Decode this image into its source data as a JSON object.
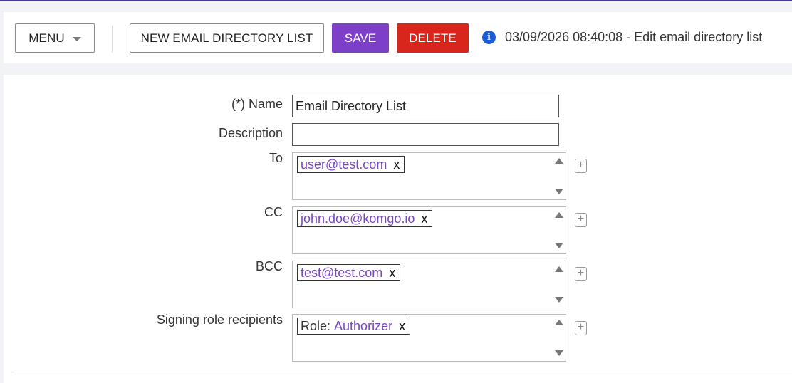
{
  "toolbar": {
    "menu_label": "MENU",
    "new_label": "NEW EMAIL DIRECTORY LIST",
    "save_label": "SAVE",
    "delete_label": "DELETE",
    "status_text": "03/09/2026 08:40:08 - Edit email directory list"
  },
  "colors": {
    "accent": "#7d3fc7",
    "danger": "#d8261c",
    "info": "#1a5bd6",
    "tag_text": "#7a45c2"
  },
  "form": {
    "name_label": "(*) Name",
    "name_value": "Email Directory List",
    "description_label": "Description",
    "description_value": "",
    "to_label": "To",
    "to_tags": [
      "user@test.com"
    ],
    "cc_label": "CC",
    "cc_tags": [
      "john.doe@komgo.io"
    ],
    "bcc_label": "BCC",
    "bcc_tags": [
      "test@test.com"
    ],
    "signing_label": "Signing role recipients",
    "signing_tag_prefix": "Role:",
    "signing_tag_value": "Authorizer",
    "remove_glyph": "x",
    "add_glyph": "+"
  },
  "icons": {
    "info": "info-icon",
    "menu_caret": "chevron-down-icon",
    "add": "plus-icon",
    "scroll_up": "scroll-up-icon",
    "scroll_down": "scroll-down-icon"
  }
}
